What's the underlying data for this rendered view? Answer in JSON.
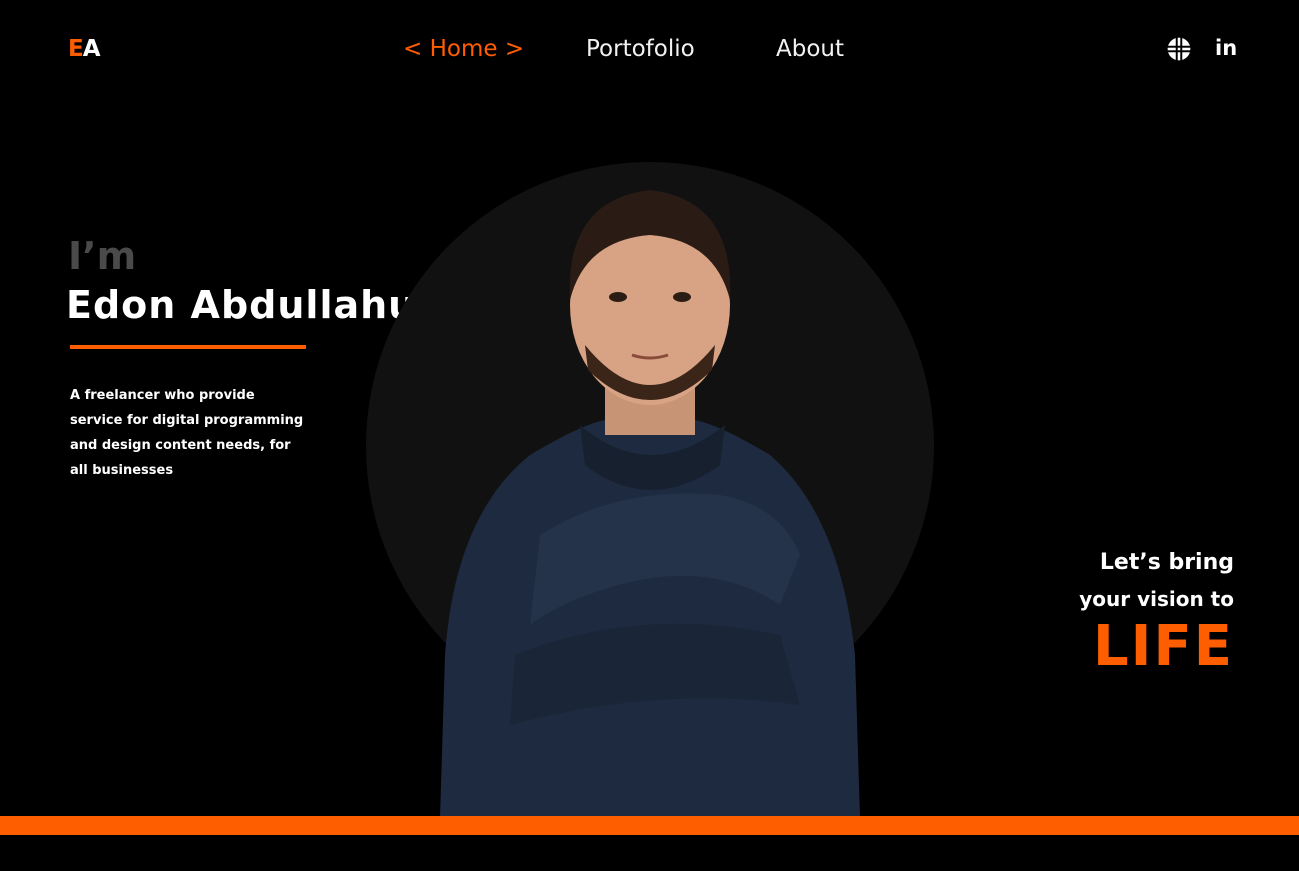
{
  "logo": {
    "part1": "E",
    "part2": "A"
  },
  "nav": {
    "items": [
      {
        "label": "< Home >",
        "active": true
      },
      {
        "label": "Portofolio",
        "active": false
      },
      {
        "label": "About",
        "active": false
      }
    ]
  },
  "social": {
    "icons": [
      "globe-icon",
      "linkedin-icon"
    ],
    "linkedin_label": "in"
  },
  "hero": {
    "greeting": "I’m",
    "name": "Edon Abdullahu",
    "bio": "A freelancer who provide service for digital programming and design content needs, for all businesses"
  },
  "cta": {
    "line1": "Let’s bring",
    "line2": "your vision to",
    "line3": "LIFE"
  },
  "colors": {
    "accent": "#ff5e00",
    "background": "#000000",
    "circle": "#111111"
  }
}
